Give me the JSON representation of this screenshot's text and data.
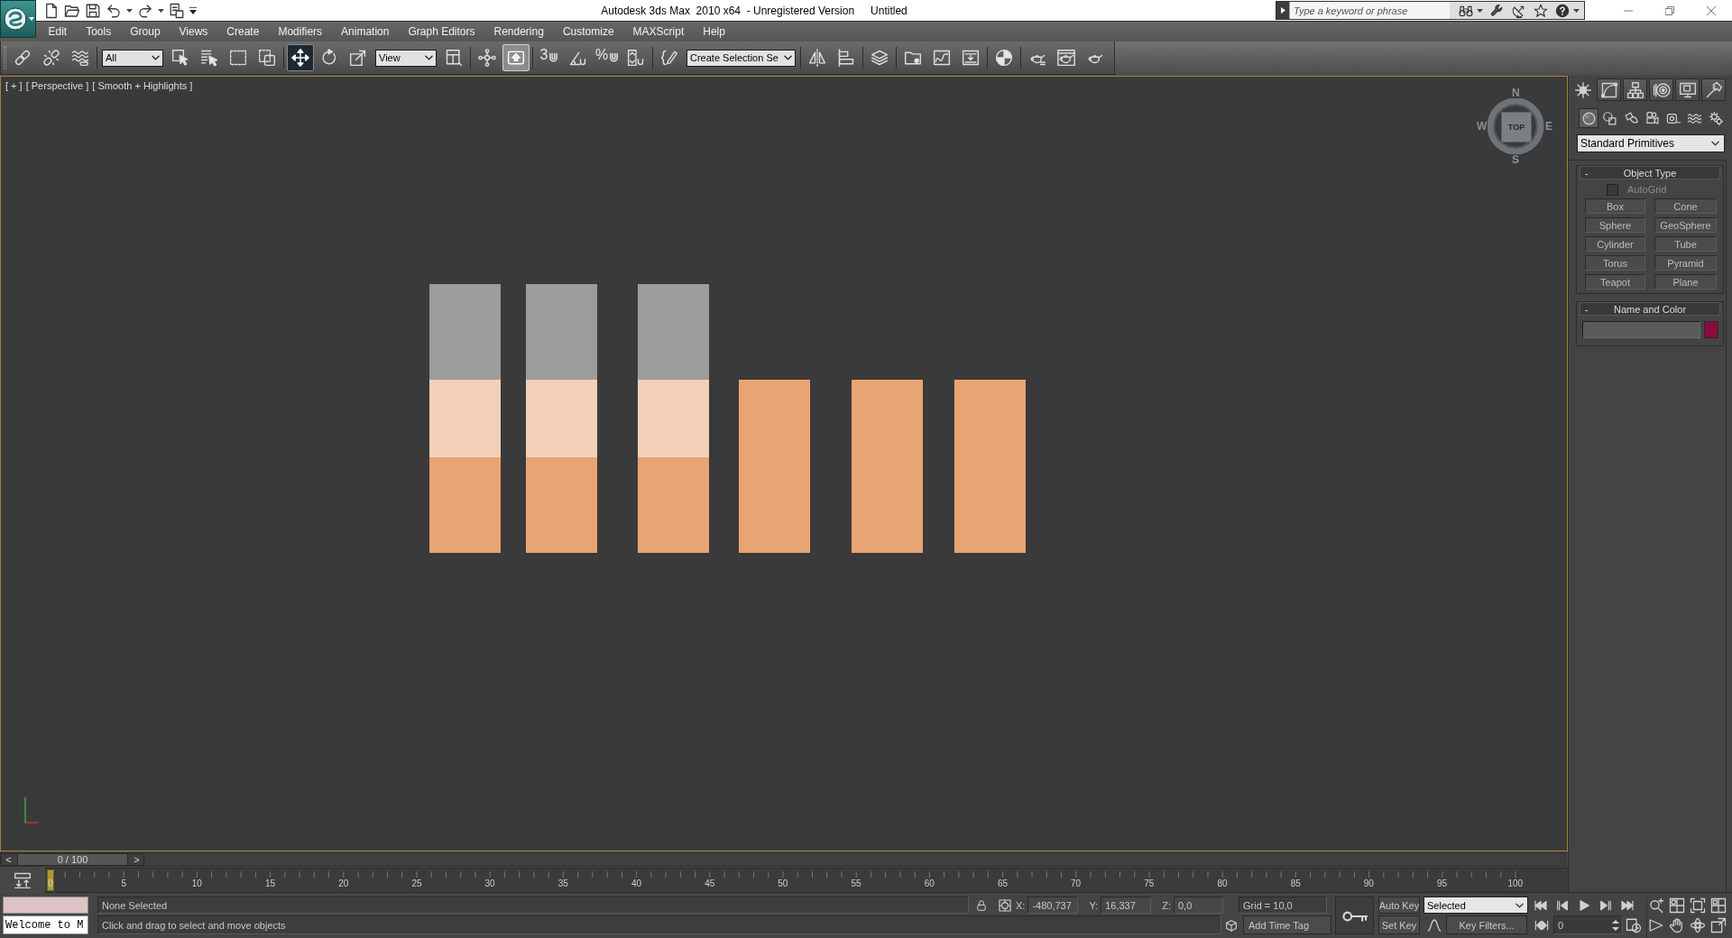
{
  "window": {
    "title": "Autodesk 3ds Max  2010 x64  - Unregistered Version",
    "document": "Untitled"
  },
  "search": {
    "placeholder": "Type a keyword or phrase"
  },
  "menu": [
    "Edit",
    "Tools",
    "Group",
    "Views",
    "Create",
    "Modifiers",
    "Animation",
    "Graph Editors",
    "Rendering",
    "Customize",
    "MAXScript",
    "Help"
  ],
  "toolbar": {
    "groups": [
      [
        {
          "kind": "link",
          "active": false
        },
        {
          "kind": "unlink",
          "active": false
        },
        {
          "kind": "bind",
          "active": false
        }
      ],
      [
        {
          "kind": "dropdown",
          "value": "All"
        },
        {
          "kind": "select",
          "active": false
        },
        {
          "kind": "select_by_name",
          "active": false
        },
        {
          "kind": "region",
          "active": false
        },
        {
          "kind": "crossing",
          "active": false
        }
      ],
      [
        {
          "kind": "move",
          "active": true
        },
        {
          "kind": "rotate",
          "active": false
        },
        {
          "kind": "scale",
          "active": false
        },
        {
          "kind": "dropdown",
          "value": "View"
        },
        {
          "kind": "pivot",
          "active": false
        }
      ],
      [
        {
          "kind": "manipulate",
          "active": false
        },
        {
          "kind": "override",
          "active": true
        }
      ],
      [
        {
          "kind": "snap",
          "label": "3",
          "active": false
        },
        {
          "kind": "angle_snap",
          "active": false
        },
        {
          "kind": "percent_snap",
          "label": "%",
          "active": false
        },
        {
          "kind": "spinner_snap",
          "active": false
        }
      ],
      [
        {
          "kind": "edit_named",
          "active": false
        },
        {
          "kind": "dropdown",
          "value": "Create Selection Se"
        }
      ],
      [
        {
          "kind": "mirror",
          "active": false
        },
        {
          "kind": "align",
          "active": false
        }
      ],
      [
        {
          "kind": "layers",
          "active": false
        }
      ],
      [
        {
          "kind": "folder",
          "active": false
        },
        {
          "kind": "curve_editor",
          "active": false
        },
        {
          "kind": "schematic",
          "active": false
        }
      ],
      [
        {
          "kind": "material",
          "active": false
        }
      ],
      [
        {
          "kind": "render_setup",
          "active": false
        },
        {
          "kind": "frame_window",
          "active": false
        },
        {
          "kind": "render",
          "active": false
        }
      ]
    ]
  },
  "viewport": {
    "labels": [
      "[ + ]",
      "[ Perspective ]",
      "[ Smooth + Highlights ]"
    ],
    "objects": [
      {
        "kind": "stack"
      },
      {
        "kind": "stack"
      },
      {
        "kind": "stack"
      },
      {
        "kind": "block"
      },
      {
        "kind": "block"
      },
      {
        "kind": "block"
      }
    ],
    "view_cube": {
      "face": "TOP",
      "north": "N",
      "east": "E",
      "south": "S",
      "west": "W"
    }
  },
  "command_panel": {
    "tabs": [
      {
        "kind": "create",
        "selected": true
      },
      {
        "kind": "modify",
        "selected": false
      },
      {
        "kind": "hierarchy",
        "selected": false
      },
      {
        "kind": "motion",
        "selected": false
      },
      {
        "kind": "display",
        "selected": false
      },
      {
        "kind": "utilities",
        "selected": false
      }
    ],
    "categories": [
      {
        "kind": "geometry",
        "selected": true
      },
      {
        "kind": "shapes",
        "selected": false
      },
      {
        "kind": "lights",
        "selected": false
      },
      {
        "kind": "cameras",
        "selected": false
      },
      {
        "kind": "helpers",
        "selected": false
      },
      {
        "kind": "space_warps",
        "selected": false
      },
      {
        "kind": "systems",
        "selected": false
      }
    ],
    "object_class": "Standard Primitives",
    "rollouts": [
      {
        "kind": "object_type",
        "toggle": "-",
        "title": "Object Type",
        "autogrid": {
          "label": "AutoGrid",
          "checked": false
        },
        "buttons": [
          "Box",
          "Cone",
          "Sphere",
          "GeoSphere",
          "Cylinder",
          "Tube",
          "Torus",
          "Pyramid",
          "Teapot",
          "Plane"
        ]
      },
      {
        "kind": "name_and_color",
        "toggle": "-",
        "title": "Name and Color",
        "color": "#8c0b3c"
      }
    ]
  },
  "time_slider": {
    "previous": "<",
    "position": "0 / 100",
    "next": ">",
    "level": 0
  },
  "track_bar": {
    "labels": [
      "0",
      "5",
      "10",
      "15",
      "20",
      "25",
      "30",
      "35",
      "40",
      "45",
      "50",
      "55",
      "60",
      "65",
      "70",
      "75",
      "80",
      "85",
      "90",
      "95",
      "100"
    ]
  },
  "status_bar": {
    "listener_input": "Welcome to M",
    "selection": "None Selected",
    "prompt": "Click and drag to select and move objects",
    "coordinates": [
      {
        "axis": "X:",
        "value": "-480,737"
      },
      {
        "axis": "Y:",
        "value": "16,337"
      },
      {
        "axis": "Z:",
        "value": "0,0"
      }
    ],
    "grid": "Grid = 10,0",
    "time_tag": "Add Time Tag",
    "auto_key": "Auto Key",
    "set_key": "Set Key",
    "key_set": "Selected",
    "key_filters": "Key Filters...",
    "current_frame": "0"
  }
}
